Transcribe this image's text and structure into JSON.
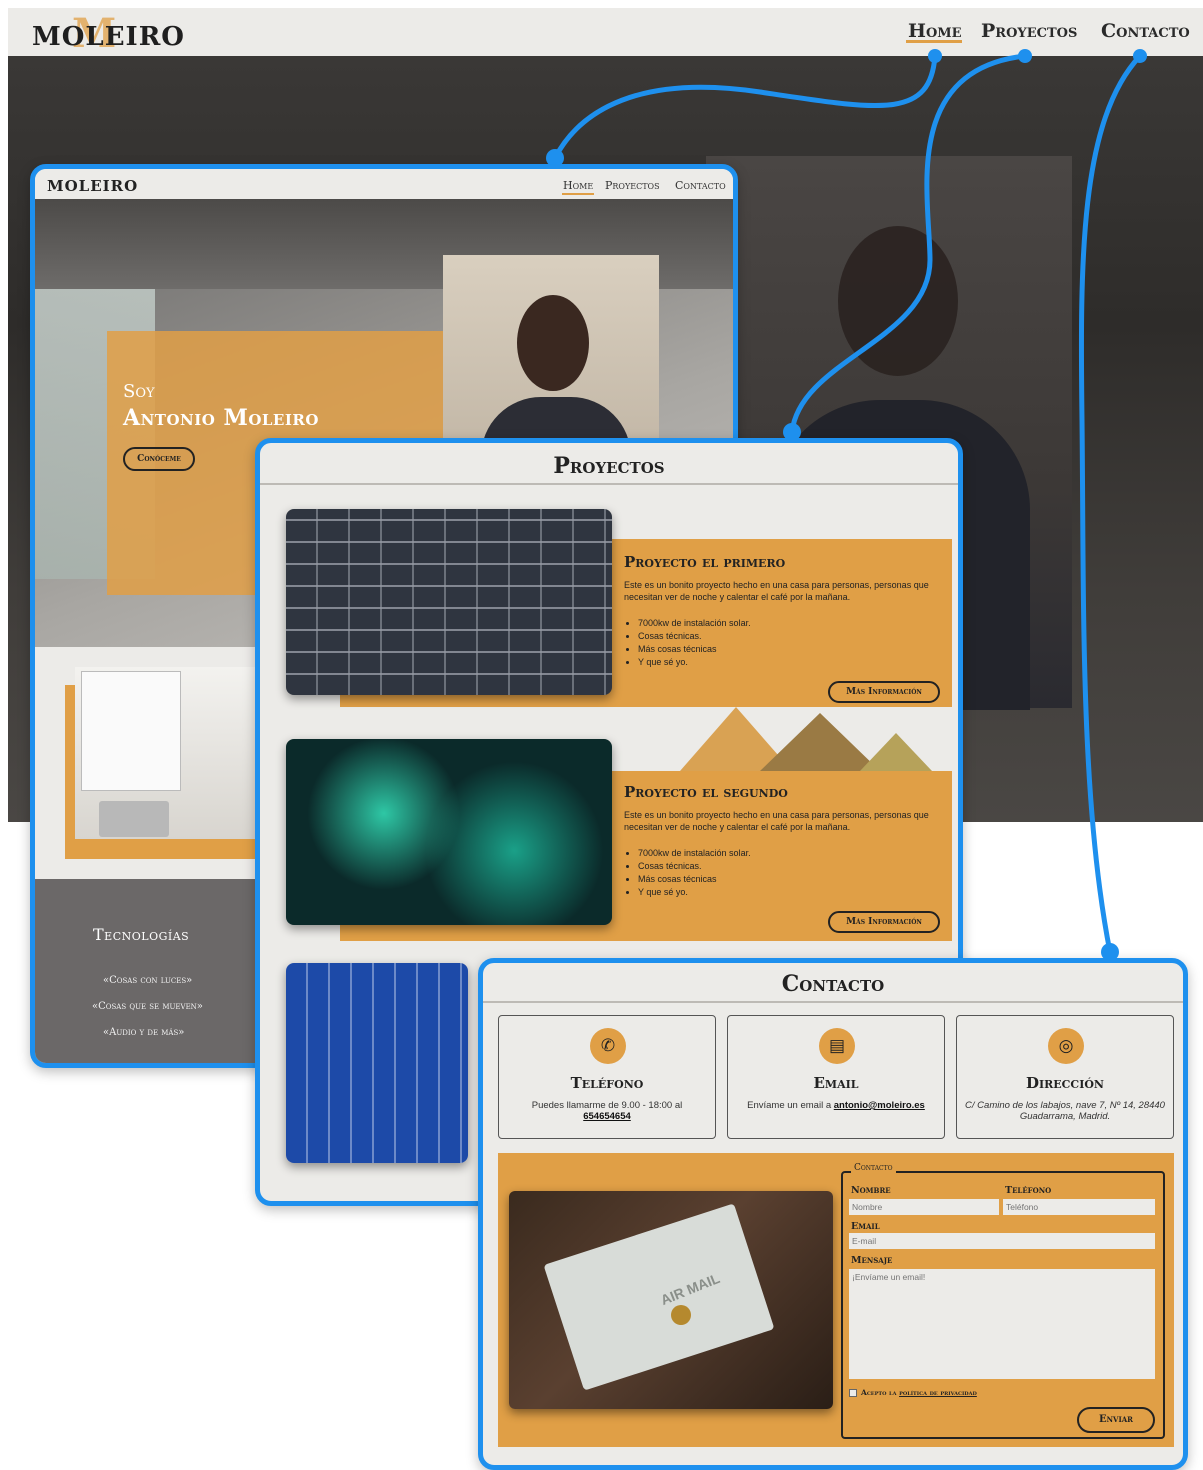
{
  "colors": {
    "accent": "#e09f46",
    "frame": "#1e90ee",
    "header_bg": "#ecebe8",
    "tech_bg": "#6b6868"
  },
  "site": {
    "logo": "MOLEIRO",
    "logo_mark": "M",
    "nav": {
      "home": "Home",
      "proyectos": "Proyectos",
      "contacto": "Contacto"
    }
  },
  "home": {
    "logo": "MOLEIRO",
    "nav": {
      "home": "Home",
      "proyectos": "Proyectos",
      "contacto": "Contacto"
    },
    "hero": {
      "greeting": "Soy",
      "name": "Antonio Moleiro",
      "button": "Conóceme"
    },
    "tech": {
      "title": "Tecnologías",
      "items": [
        "«Cosas con luces»",
        "«Cosas que se mueven»",
        "«Audio y de más»"
      ]
    }
  },
  "proyectos": {
    "title": "Proyectos",
    "items": [
      {
        "title": "Proyecto el primero",
        "desc": "Este es un bonito proyecto hecho en una casa para personas, personas que necesitan ver de noche y calentar el café por la mañana.",
        "bullets": [
          "7000kw de instalación solar.",
          "Cosas técnicas.",
          "Más cosas técnicas",
          "Y que sé yo."
        ],
        "button": "Más Información"
      },
      {
        "title": "Proyecto el segundo",
        "desc": "Este es un bonito proyecto hecho en una casa para personas, personas que necesitan ver de noche y calentar el café por la mañana.",
        "bullets": [
          "7000kw de instalación solar.",
          "Cosas técnicas.",
          "Más cosas técnicas",
          "Y que sé yo."
        ],
        "button": "Más Información"
      }
    ]
  },
  "contacto": {
    "title": "Contacto",
    "cards": {
      "telefono": {
        "icon": "phone-icon",
        "title": "Teléfono",
        "text": "Puedes llamarme de 9.00 - 18:00 al",
        "link": "654654654"
      },
      "email": {
        "icon": "chat-icon",
        "title": "Email",
        "text": "Envíame un email a",
        "link": "antonio@moleiro.es"
      },
      "direccion": {
        "icon": "location-pin-icon",
        "title": "Dirección",
        "text": "C/ Camino de los labajos, nave 7, Nº 14, 28440 Guadarrama, Madrid."
      }
    },
    "photo_text": "AIR MAIL",
    "form": {
      "legend": "Contacto",
      "nombre_label": "Nombre",
      "nombre_placeholder": "Nombre",
      "telefono_label": "Teléfono",
      "telefono_placeholder": "Teléfono",
      "email_label": "Email",
      "email_placeholder": "E-mail",
      "mensaje_label": "Mensaje",
      "mensaje_placeholder": "¡Envíame un email!",
      "privacy_prefix": "Acepto la",
      "privacy_link": "política de privacidad",
      "submit": "Enviar"
    }
  }
}
